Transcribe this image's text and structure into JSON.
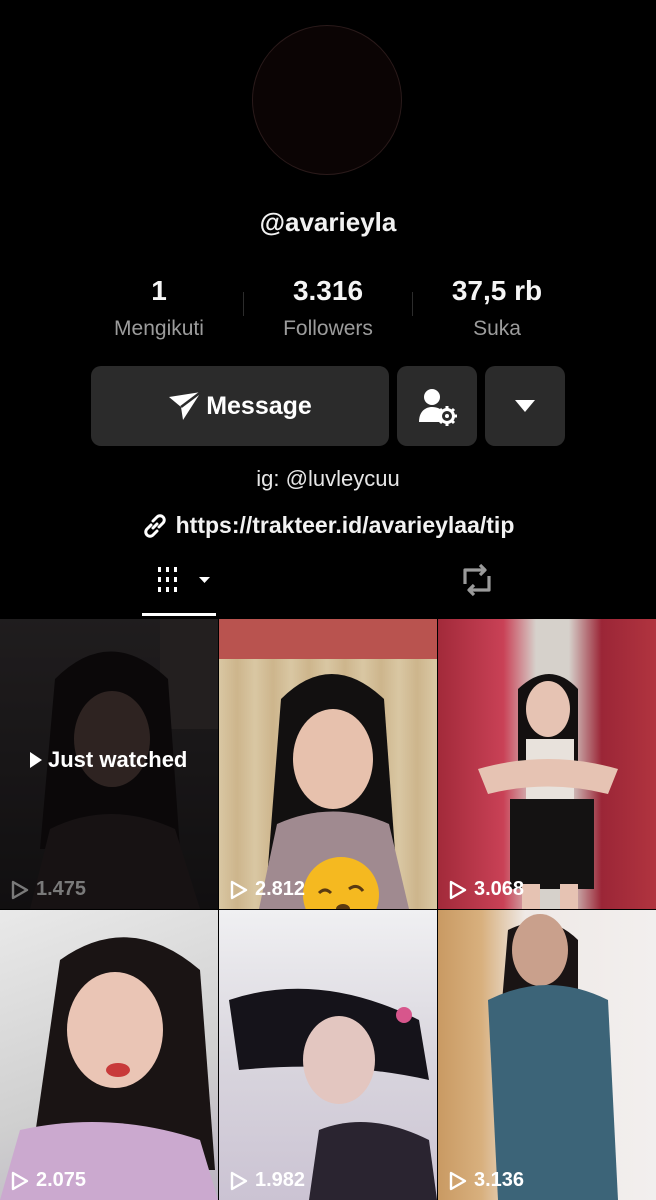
{
  "profile": {
    "username": "@avarieyla",
    "stats": [
      {
        "value": "1",
        "label": "Mengikuti"
      },
      {
        "value": "3.316",
        "label": "Followers"
      },
      {
        "value": "37,5 rb",
        "label": "Suka"
      }
    ],
    "message_label": "Message",
    "bio": "ig: @luvleycuu",
    "link": "https://trakteer.id/avarieylaa/tip"
  },
  "tabs": [
    {
      "icon": "videos-grid-icon",
      "selected": true
    },
    {
      "icon": "repost-icon",
      "selected": false
    }
  ],
  "videos": [
    {
      "views": "1.475",
      "badge": "Just watched",
      "dimmed": true
    },
    {
      "views": "2.812"
    },
    {
      "views": "3.068"
    },
    {
      "views": "2.075"
    },
    {
      "views": "1.982"
    },
    {
      "views": "3.136"
    }
  ],
  "colors": {
    "background": "#000000",
    "button": "#2b2b2b",
    "secondary_text": "#9c9c9c"
  }
}
